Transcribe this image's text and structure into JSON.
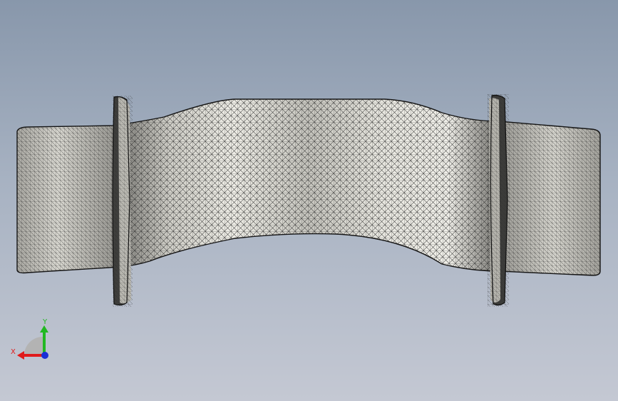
{
  "viewport": {
    "background_top": "#8897ab",
    "background_bottom": "#c4c8d3"
  },
  "model": {
    "part": "turbine-blade-mesh",
    "render_mode": "wireframe-shaded",
    "surface_color": "#c9c8c0",
    "edge_color": "#1f1f1f"
  },
  "triad": {
    "x_label": "X",
    "y_label": "Y",
    "x_color": "#e01b1b",
    "y_color": "#22b822",
    "z_color": "#1a2fd6"
  }
}
